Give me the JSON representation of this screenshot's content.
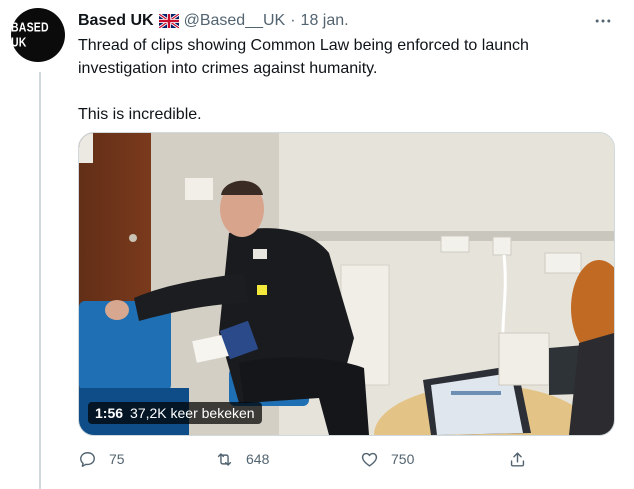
{
  "tweet": {
    "avatar_text": "BASED UK",
    "name": "Based UK",
    "flag_icon": "uk-flag-icon",
    "handle": "@Based__UK",
    "separator": "·",
    "date": "18 jan.",
    "text_line1": "Thread of clips showing Common Law being enforced to launch investigation into crimes against humanity.",
    "text_line2": "This is incredible.",
    "video": {
      "duration": "1:56",
      "views": "37,2K keer bekeken"
    },
    "actions": {
      "reply_count": "75",
      "retweet_count": "648",
      "like_count": "750"
    }
  },
  "colors": {
    "text_primary": "#0f1419",
    "text_secondary": "#536471",
    "divider": "#cfd9de"
  }
}
